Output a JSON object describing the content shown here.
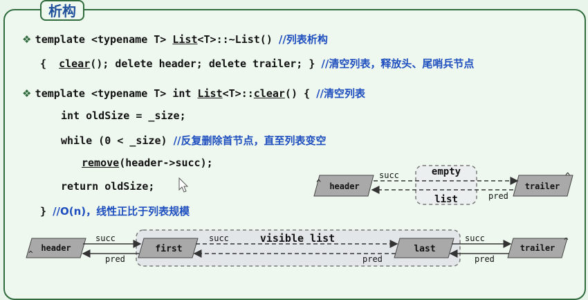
{
  "title": "析构",
  "lines": {
    "l1_code_a": "template <typename T> ",
    "l1_list": "List",
    "l1_code_b": "<T>::~List() ",
    "l1_cmt": "//列表析构",
    "l2_code_a": "{  ",
    "l2_clear": "clear",
    "l2_code_b": "(); delete header; delete trailer; } ",
    "l2_cmt": "//清空列表，释放头、尾哨兵节点",
    "l3_code_a": "template <typename T> int ",
    "l3_list": "List",
    "l3_code_b": "<T>::",
    "l3_clear": "clear",
    "l3_code_c": "() { ",
    "l3_cmt": "//清空列表",
    "l4_code": "int oldSize = _size;",
    "l5_code": "while (0 < _size) ",
    "l5_cmt": "//反复删除首节点，直至列表变空",
    "l6_remove": "remove",
    "l6_code": "(header->succ);",
    "l7_code": "return oldSize;",
    "l8_code": "} ",
    "l8_cmt": "//O(n)，线性正比于列表规模"
  },
  "diagram_empty": {
    "header": "header",
    "trailer": "trailer",
    "empty": "empty",
    "list": "list",
    "succ": "succ",
    "pred": "pred",
    "caret": "^"
  },
  "diagram_full": {
    "header": "header",
    "first": "first",
    "last": "last",
    "trailer": "trailer",
    "visible_list": "visible list",
    "succ": "succ",
    "pred": "pred",
    "caret": "^"
  },
  "colors": {
    "frame": "#2f6b3c",
    "comment": "#1f4fbf",
    "node": "#a9a9a9"
  }
}
